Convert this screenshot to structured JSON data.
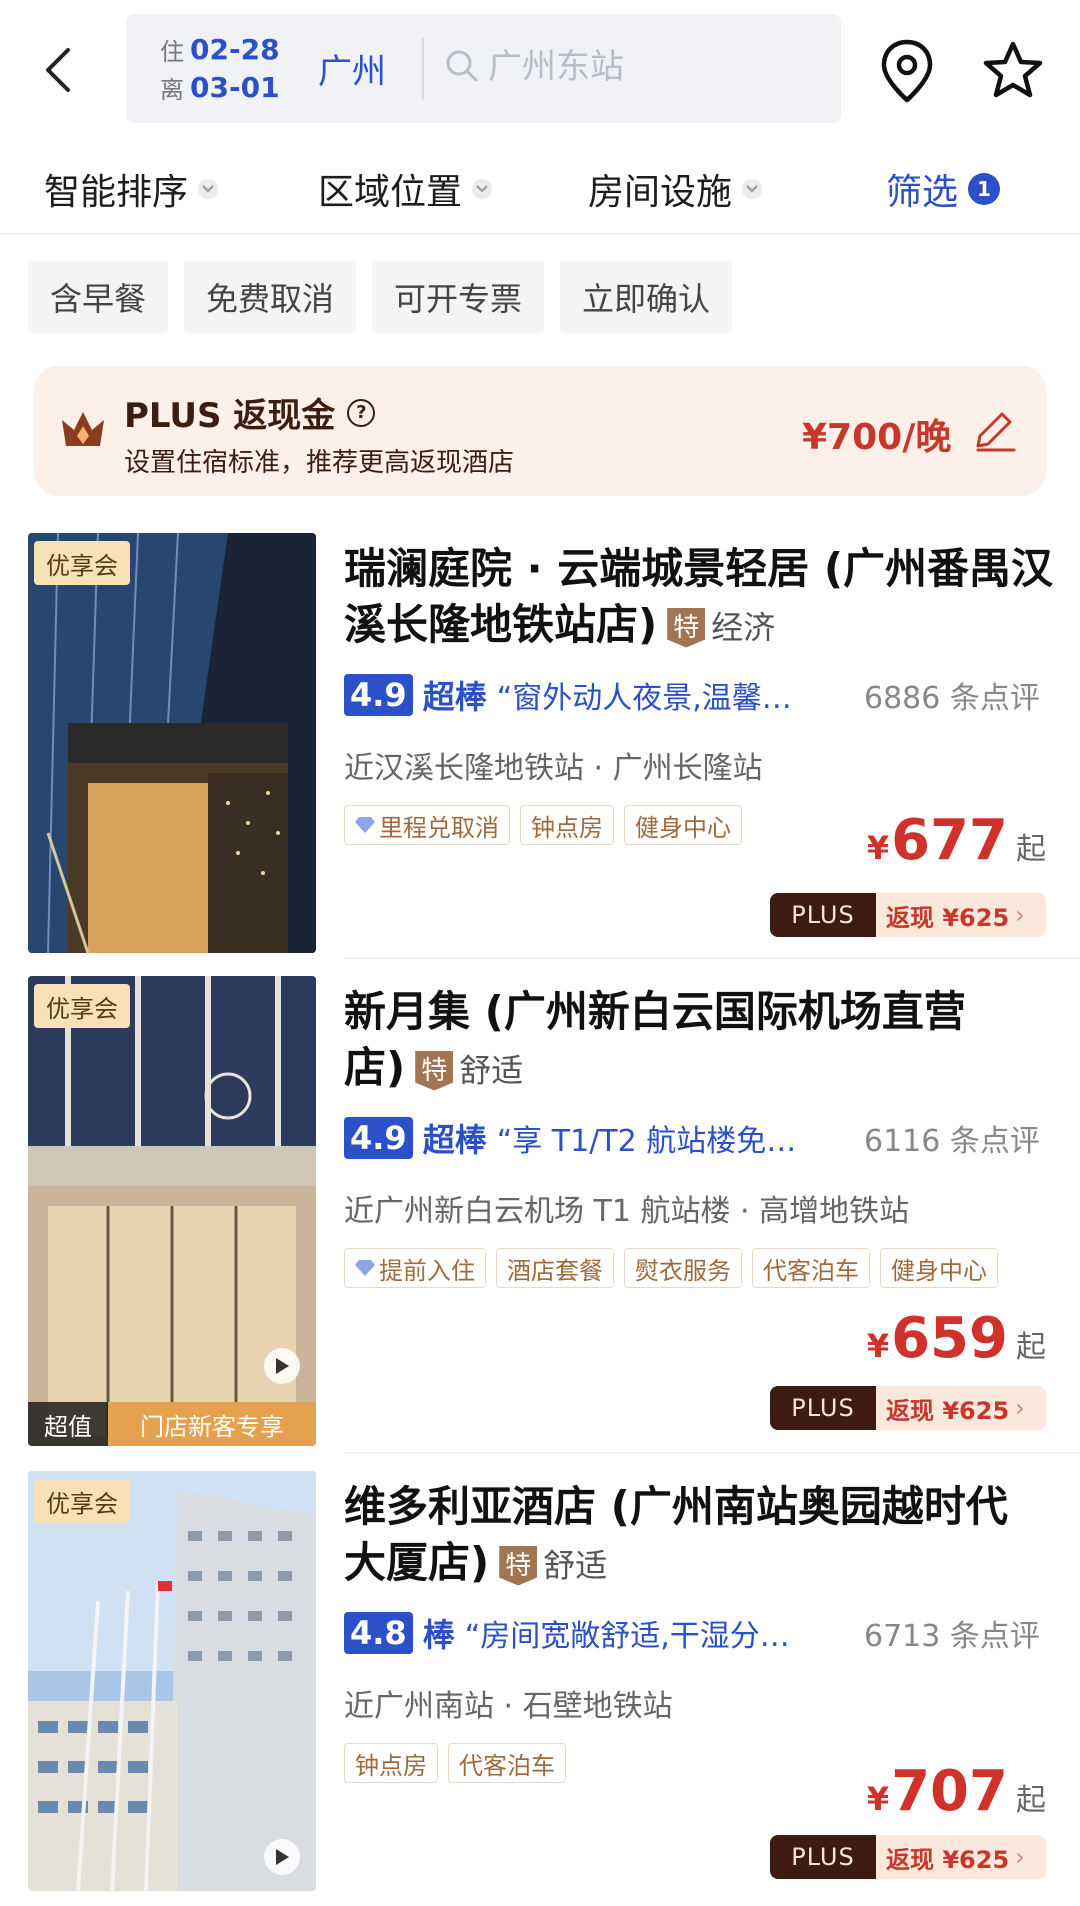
{
  "header": {
    "checkin_label": "住",
    "checkin_date": "02-28",
    "checkout_label": "离",
    "checkout_date": "03-01",
    "city": "广州",
    "search_placeholder": "广州东站"
  },
  "sortbar": [
    {
      "label": "智能排序"
    },
    {
      "label": "区域位置"
    },
    {
      "label": "房间设施"
    },
    {
      "label": "筛选",
      "count": "1"
    }
  ],
  "chips": [
    "含早餐",
    "免费取消",
    "可开专票",
    "立即确认"
  ],
  "plus_banner": {
    "title": "PLUS 返现金",
    "help": "?",
    "subtitle": "设置住宿标准，推荐更高返现酒店",
    "amount": "¥700/晚"
  },
  "hotels": [
    {
      "member_badge": "优享会",
      "name": "瑞澜庭院 · 云端城景轻居 (广州番禺汉溪长隆地铁站店)",
      "te": "特",
      "tier": "经济",
      "score": "4.9",
      "rating_word": "超棒",
      "review": "“窗外动人夜景,温馨…",
      "review_count": "6886 条点评",
      "near": "近汉溪长隆地铁站 · 广州长隆站",
      "amenities": [
        "里程兑取消",
        "钟点房",
        "健身中心"
      ],
      "currency": "¥",
      "price": "677",
      "price_suffix": "起",
      "plus_label": "PLUS",
      "cashback": "返现 ¥625"
    },
    {
      "member_badge": "优享会",
      "name": "新月集 (广州新白云国际机场直营店)",
      "te": "特",
      "tier": "舒适",
      "score": "4.9",
      "rating_word": "超棒",
      "review": "“享 T1/T2 航站楼免…",
      "review_count": "6116 条点评",
      "near": "近广州新白云机场 T1 航站楼 · 高增地铁站",
      "amenities": [
        "提前入住",
        "酒店套餐",
        "熨衣服务",
        "代客泊车",
        "健身中心"
      ],
      "photo_band_left": "超值",
      "photo_band_right": "门店新客专享",
      "currency": "¥",
      "price": "659",
      "price_suffix": "起",
      "plus_label": "PLUS",
      "cashback": "返现 ¥625"
    },
    {
      "member_badge": "优享会",
      "name": "维多利亚酒店 (广州南站奥园越时代大厦店)",
      "te": "特",
      "tier": "舒适",
      "score": "4.8",
      "rating_word": "棒",
      "review": "“房间宽敞舒适,干湿分…",
      "review_count": "6713 条点评",
      "near": "近广州南站 · 石壁地铁站",
      "amenities": [
        "钟点房",
        "代客泊车"
      ],
      "currency": "¥",
      "price": "707",
      "price_suffix": "起",
      "plus_label": "PLUS",
      "cashback": "返现 ¥625"
    }
  ],
  "colors": {
    "accent": "#2b50c8",
    "price": "#d0312a",
    "plus_dark": "#3f1a12",
    "banner_bg": "#fdf0e8"
  }
}
